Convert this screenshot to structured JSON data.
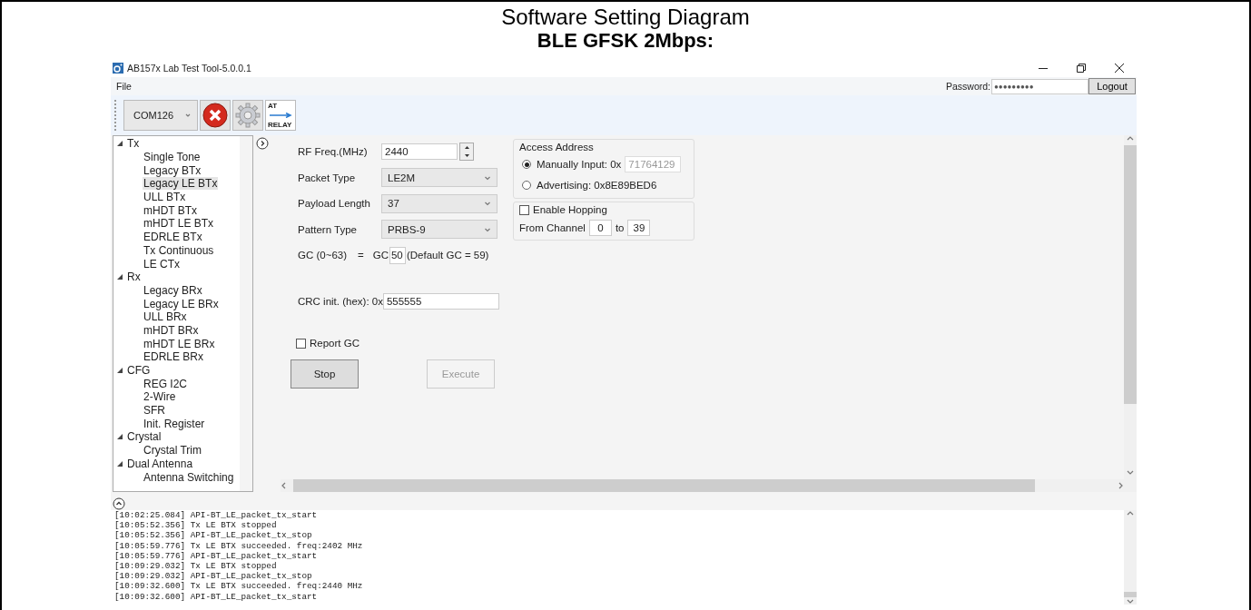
{
  "document": {
    "title": "Software Setting Diagram",
    "subtitle": "BLE GFSK 2Mbps:"
  },
  "window": {
    "title": "AB157x Lab Test Tool-5.0.0.1"
  },
  "menu": [
    "File"
  ],
  "login": {
    "label": "Password:",
    "value": "●●●●●●●●●",
    "button": "Logout"
  },
  "toolbar": {
    "port": "COM126",
    "relay_top": "AT",
    "relay_bottom": "RELAY"
  },
  "tree": [
    {
      "label": "Tx",
      "expanded": true,
      "children": [
        {
          "label": "Single Tone",
          "selected": false
        },
        {
          "label": "Legacy BTx",
          "selected": false
        },
        {
          "label": "Legacy LE BTx",
          "selected": true
        },
        {
          "label": "ULL BTx",
          "selected": false
        },
        {
          "label": "mHDT BTx",
          "selected": false
        },
        {
          "label": "mHDT LE BTx",
          "selected": false
        },
        {
          "label": "EDRLE BTx",
          "selected": false
        },
        {
          "label": "Tx Continuous",
          "selected": false
        },
        {
          "label": "LE CTx",
          "selected": false
        }
      ]
    },
    {
      "label": "Rx",
      "expanded": true,
      "children": [
        {
          "label": "Legacy BRx",
          "selected": false
        },
        {
          "label": "Legacy LE BRx",
          "selected": false
        },
        {
          "label": "ULL BRx",
          "selected": false
        },
        {
          "label": "mHDT BRx",
          "selected": false
        },
        {
          "label": "mHDT LE BRx",
          "selected": false
        },
        {
          "label": "EDRLE BRx",
          "selected": false
        }
      ]
    },
    {
      "label": "CFG",
      "expanded": true,
      "children": [
        {
          "label": "REG I2C",
          "selected": false
        },
        {
          "label": "2-Wire",
          "selected": false
        },
        {
          "label": "SFR",
          "selected": false
        },
        {
          "label": "Init. Register",
          "selected": false
        }
      ]
    },
    {
      "label": "Crystal",
      "expanded": true,
      "children": [
        {
          "label": "Crystal Trim",
          "selected": false
        }
      ]
    },
    {
      "label": "Dual Antenna",
      "expanded": true,
      "children": [
        {
          "label": "Antenna Switching",
          "selected": false
        }
      ]
    }
  ],
  "form": {
    "rows": [
      {
        "kind": "spin",
        "label": "RF Freq.(MHz)",
        "value": "2440"
      },
      {
        "kind": "select",
        "label": "Packet Type",
        "value": "LE2M"
      },
      {
        "kind": "select",
        "label": "Payload Length",
        "value": "37"
      },
      {
        "kind": "select",
        "label": "Pattern Type",
        "value": "PRBS-9"
      },
      {
        "kind": "gc",
        "label": "GC (0~63)",
        "equals": "=",
        "prefix": "GC",
        "value": "50",
        "note": "(Default GC = 59)"
      }
    ],
    "crc": {
      "label": "CRC init. (hex): 0x",
      "value": "555555"
    },
    "report_gc": {
      "label": "Report GC",
      "checked": false
    },
    "buttons": [
      {
        "label": "Stop",
        "disabled": false
      },
      {
        "label": "Execute",
        "disabled": true
      }
    ],
    "access_address": {
      "title": "Access Address",
      "options": [
        {
          "label": "Manually Input: 0x",
          "value": "71764129",
          "selected": true
        },
        {
          "label": "Advertising: 0x8E89BED6",
          "selected": false
        }
      ]
    },
    "hopping": {
      "label": "Enable Hopping",
      "checked": false,
      "from_label": "From Channel",
      "from": "0",
      "to_label": "to",
      "to": "39"
    }
  },
  "log": [
    "[10:02:25.084] API-BT_LE_packet_tx_start",
    "[10:05:52.356] Tx LE BTX stopped",
    "[10:05:52.356] API-BT_LE_packet_tx_stop",
    "[10:05:59.776] Tx LE BTX succeeded. freq:2402 MHz",
    "[10:05:59.776] API-BT_LE_packet_tx_start",
    "[10:09:29.032] Tx LE BTX stopped",
    "[10:09:29.032] API-BT_LE_packet_tx_stop",
    "[10:09:32.600] Tx LE BTX succeeded. freq:2440 MHz",
    "[10:09:32.600] API-BT_LE_packet_tx_start"
  ]
}
